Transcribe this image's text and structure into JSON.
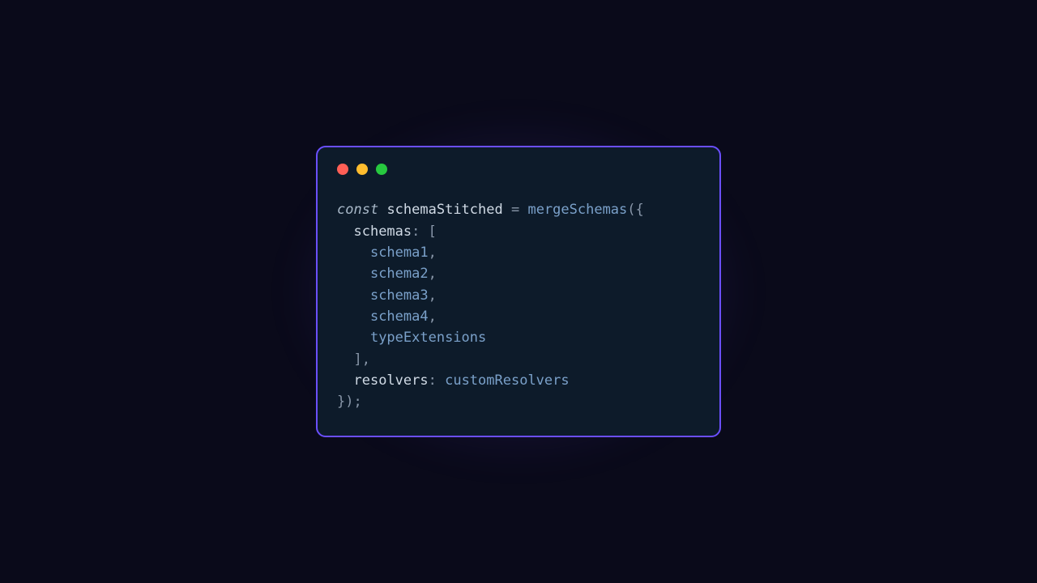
{
  "code": {
    "keyword_const": "const",
    "var_name": "schemaStitched",
    "equals": " = ",
    "func_name": "mergeSchemas",
    "open": "({",
    "prop_schemas": "schemas",
    "colon_bracket": ": [",
    "item1": "schema1",
    "item2": "schema2",
    "item3": "schema3",
    "item4": "schema4",
    "item5": "typeExtensions",
    "close_bracket": "],",
    "prop_resolvers": "resolvers",
    "colon2": ": ",
    "resolvers_value": "customResolvers",
    "close": "});",
    "comma": ","
  }
}
